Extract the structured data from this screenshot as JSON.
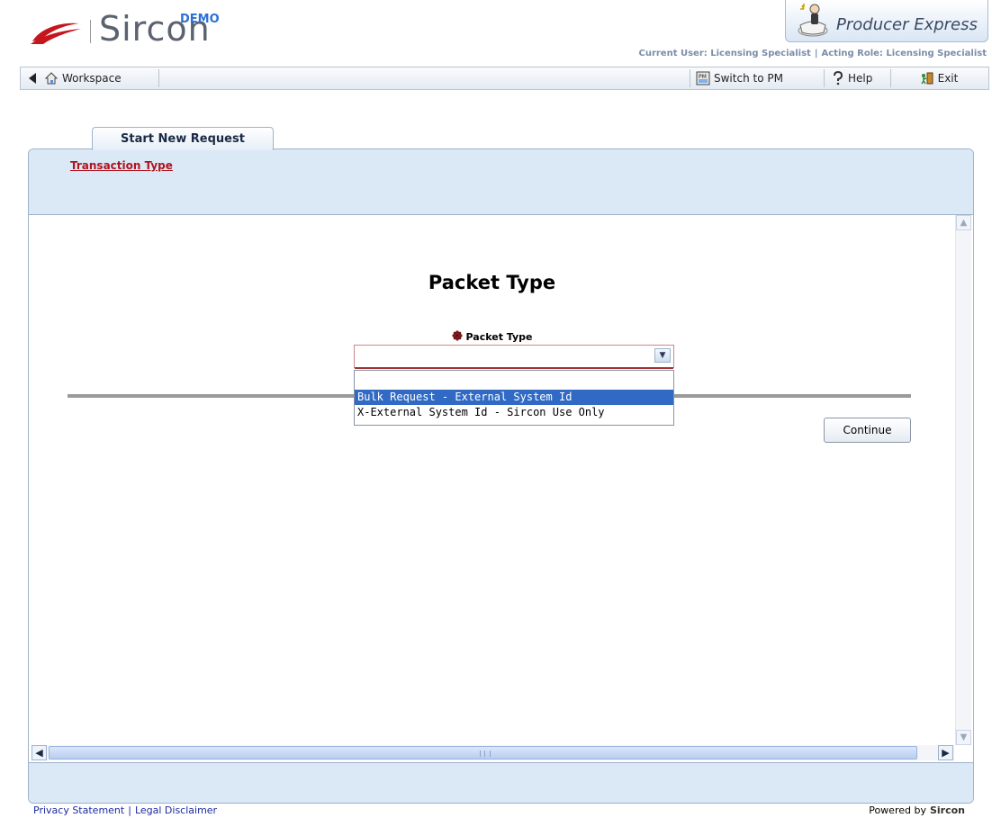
{
  "header": {
    "logo_text": "Sircon",
    "logo_badge": "DEMO",
    "product_name": "Producer Express",
    "current_user_label": "Current User: Licensing Specialist",
    "acting_role_label": "Acting Role: Licensing Specialist",
    "separator": "|"
  },
  "toolbar": {
    "workspace_label": "Workspace",
    "switch_pm_label": "Switch to PM",
    "help_label": "Help",
    "exit_label": "Exit"
  },
  "tab": {
    "label": "Start New Request"
  },
  "breadcrumb": {
    "link_label": "Transaction Type"
  },
  "main": {
    "title": "Packet Type",
    "field_label": "Packet Type",
    "select_value": "",
    "options": [
      "",
      "Bulk Request - External System Id",
      "X-External System Id - Sircon Use Only"
    ],
    "highlighted_option_index": 1,
    "continue_label": "Continue"
  },
  "footer": {
    "privacy_label": "Privacy Statement",
    "separator": "|",
    "legal_label": "Legal Disclaimer",
    "powered_by_label": "Powered by",
    "powered_by_brand": "Sircon"
  },
  "colors": {
    "accent_red": "#b0141e",
    "panel_blue": "#dbe8f6",
    "selected_option": "#316ac5"
  }
}
